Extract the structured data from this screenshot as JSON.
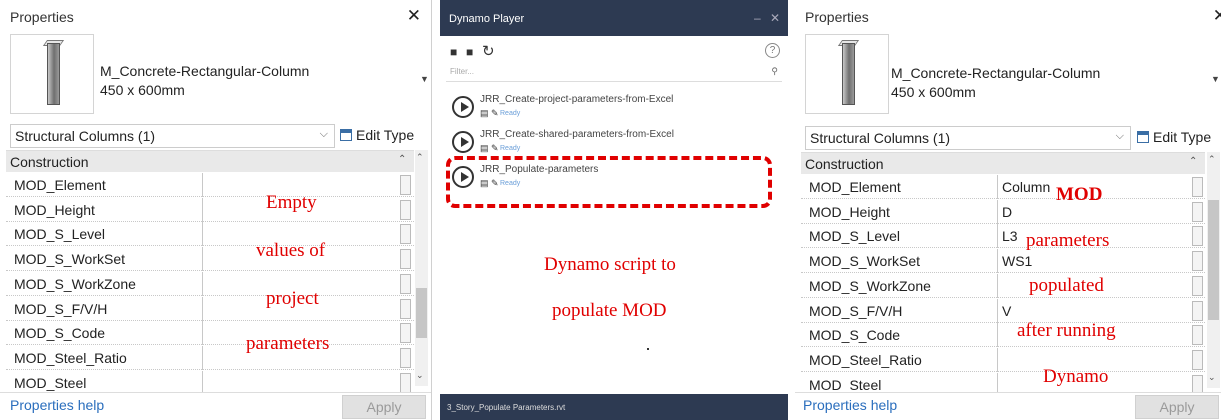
{
  "properties_panel": {
    "title": "Properties",
    "close": "✕",
    "type_name_line1": "M_Concrete-Rectangular-Column",
    "type_name_line2": "450 x 600mm",
    "category": "Structural Columns (1)",
    "edit_type": "Edit Type",
    "group": "Construction",
    "help": "Properties help",
    "apply": "Apply"
  },
  "left_rows": [
    {
      "name": "MOD_Element",
      "value": ""
    },
    {
      "name": "MOD_Height",
      "value": ""
    },
    {
      "name": "MOD_S_Level",
      "value": ""
    },
    {
      "name": "MOD_S_WorkSet",
      "value": ""
    },
    {
      "name": "MOD_S_WorkZone",
      "value": ""
    },
    {
      "name": "MOD_S_F/V/H",
      "value": ""
    },
    {
      "name": "MOD_S_Code",
      "value": ""
    },
    {
      "name": "MOD_Steel_Ratio",
      "value": ""
    },
    {
      "name": "MOD_Steel",
      "value": ""
    }
  ],
  "right_rows": [
    {
      "name": "MOD_Element",
      "value": "Column"
    },
    {
      "name": "MOD_Height",
      "value": "D"
    },
    {
      "name": "MOD_S_Level",
      "value": "L3"
    },
    {
      "name": "MOD_S_WorkSet",
      "value": "WS1"
    },
    {
      "name": "MOD_S_WorkZone",
      "value": ""
    },
    {
      "name": "MOD_S_F/V/H",
      "value": "V"
    },
    {
      "name": "MOD_S_Code",
      "value": ""
    },
    {
      "name": "MOD_Steel_Ratio",
      "value": ""
    },
    {
      "name": "MOD_Steel",
      "value": ""
    }
  ],
  "annotations": {
    "left": [
      "Empty",
      "values of",
      "project",
      "parameters"
    ],
    "middle": [
      "Dynamo script to",
      "populate MOD"
    ],
    "right": [
      "MOD",
      "parameters",
      "populated",
      "after running",
      "Dynamo"
    ],
    "color": "#e00000"
  },
  "dynamo_player": {
    "title": "Dynamo Player",
    "minimize": "–",
    "close": "✕",
    "help": "?",
    "filter_placeholder": "Filter...",
    "scripts": [
      {
        "name": "JRR_Create-project-parameters-from-Excel",
        "status": "Ready"
      },
      {
        "name": "JRR_Create-shared-parameters-from-Excel",
        "status": "Ready"
      },
      {
        "name": "JRR_Populate-parameters",
        "status": "Ready"
      }
    ],
    "footer": "3_Story_Populate Parameters.rvt",
    "header_color": "#2d3a52"
  }
}
